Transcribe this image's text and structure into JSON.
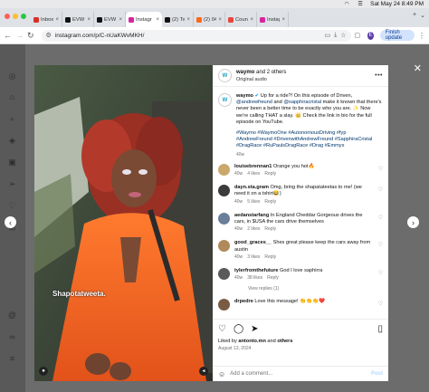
{
  "menubar": {
    "datetime": "Sat May 24  8:49 PM"
  },
  "tabs": [
    {
      "label": "Inbox (",
      "favicon": "gmail",
      "color": "#d93025"
    },
    {
      "label": "EVW (",
      "favicon": "x",
      "color": "#111111"
    },
    {
      "label": "EVW (",
      "favicon": "x",
      "color": "#111111"
    },
    {
      "label": "Instagr",
      "favicon": "instagram",
      "color": "#d6249f"
    },
    {
      "label": "(2) Tw",
      "favicon": "tiktok",
      "color": "#111111"
    },
    {
      "label": "(2) 04",
      "favicon": "substack",
      "color": "#ff6719"
    },
    {
      "label": "Counc",
      "favicon": "counc",
      "color": "#e8453c"
    },
    {
      "label": "Instag",
      "favicon": "instagram",
      "color": "#d6249f"
    }
  ],
  "toolbar": {
    "url": "instagram.com/p/C-nUaKWvMKH/",
    "profile_initial": "E",
    "finish_update": "Finish update"
  },
  "video": {
    "overlay_text": "Shapotatweeta."
  },
  "post": {
    "author": "waymo",
    "coauthors": "and 2 others",
    "audio": "Original audio",
    "caption_author": "waymo",
    "caption_parts": [
      {
        "t": "Up for a ride?! On this episode of Driven, ",
        "link": false
      },
      {
        "t": "@andrewfreund",
        "link": true
      },
      {
        "t": " and ",
        "link": false
      },
      {
        "t": "@sapphiracristal",
        "link": true
      },
      {
        "t": " make it known that there's never been a better time to be exactly who you are. ✨ Now we're calling THAT a slay. 👑 Check the link in bio for the full episode on YouTube.",
        "link": false
      }
    ],
    "hashtags": "#Waymo #WaymoOne #AutonomousDriving #fyp #AndrewFreund #DrivenwithAndrewFreund #SapphiraCristal #DragRace #RuPaulsDragRace #Drag #Emmys",
    "caption_age": "40w",
    "comments": [
      {
        "user": "louisebrennan1",
        "text": "Orange you hot🔥",
        "age": "40w",
        "likes": "4 likes",
        "reply": "Reply",
        "avatar": "#c9a86a"
      },
      {
        "user": "dayn.sta.gram",
        "text": "Omg, bring the shapatateetas to me! (we need it on a tshirt😂)",
        "age": "40w",
        "likes": "5 likes",
        "reply": "Reply",
        "avatar": "#3b3b3b"
      },
      {
        "user": "aedanstarfang",
        "text": "In England Cheddar Gorgeous drives the cars, in $USA the cars drive themselves",
        "age": "40w",
        "likes": "2 likes",
        "reply": "Reply",
        "avatar": "#6b7f9a"
      },
      {
        "user": "good_graces__",
        "text": "Shes great please keep the cars away from austin",
        "age": "40w",
        "likes": "3 likes",
        "reply": "Reply",
        "avatar": "#b08a5a"
      },
      {
        "user": "tylerfromthefuture",
        "text": "God I love saphirra",
        "age": "40w",
        "likes": "38 likes",
        "reply": "Reply",
        "avatar": "#5a5a5a",
        "view_replies": "View replies (1)"
      },
      {
        "user": "drpedre",
        "text": "Love this message! 👏👏👏❤️",
        "age": "",
        "likes": "",
        "reply": "",
        "avatar": "#7a5c44"
      }
    ],
    "liked_by_prefix": "Liked by",
    "liked_by_user": "antonto.mn",
    "liked_by_suffix": "and",
    "liked_by_others": "others",
    "date": "August 13, 2024",
    "add_comment_placeholder": "Add a comment...",
    "post_label": "Post"
  }
}
